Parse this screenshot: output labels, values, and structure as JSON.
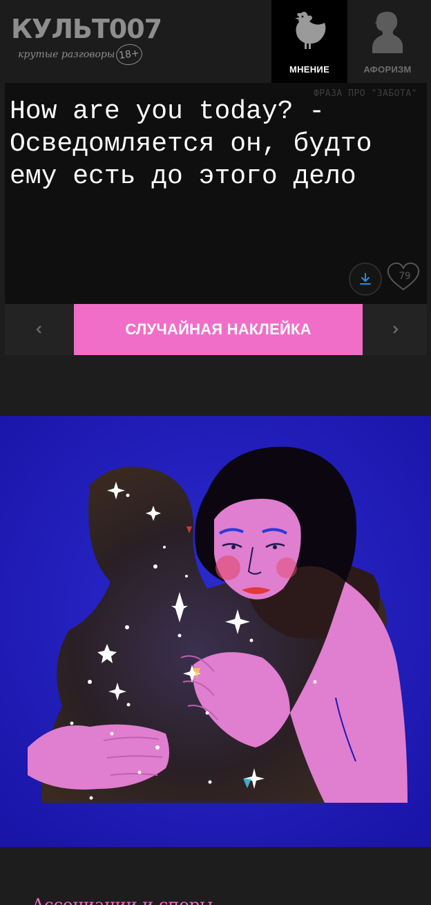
{
  "header": {
    "logo_title": "КУЛЬТ007",
    "logo_subtitle": "крутые разговоры",
    "age_badge": "18+",
    "tabs": [
      {
        "label": "МНЕНИЕ",
        "icon": "hen-icon",
        "active": true
      },
      {
        "label": "АФОРИЗМ",
        "icon": "thinker-bust-icon",
        "active": false
      }
    ]
  },
  "phrase": {
    "topic": "ФРАЗА ПРО \"ЗАБОТА\"",
    "text": "How are you today? - Осведомляется он, будто ему есть до этого дело",
    "like_count": "79",
    "download_icon": "download-icon",
    "like_icon": "heart-icon"
  },
  "actions": {
    "prev_icon": "chevron-left-icon",
    "next_icon": "chevron-right-icon",
    "random_label": "СЛУЧАЙНАЯ НАКЛЕЙКА"
  },
  "illustration": {
    "subject": "embrace-illustration"
  },
  "below": {
    "heading": "Ассоциации и споры"
  },
  "colors": {
    "accent_pink": "#f06ec8",
    "page_bg": "#1d1d1d",
    "card_bg": "#0f0f0f",
    "illustration_bg": "#1e1ab0"
  }
}
